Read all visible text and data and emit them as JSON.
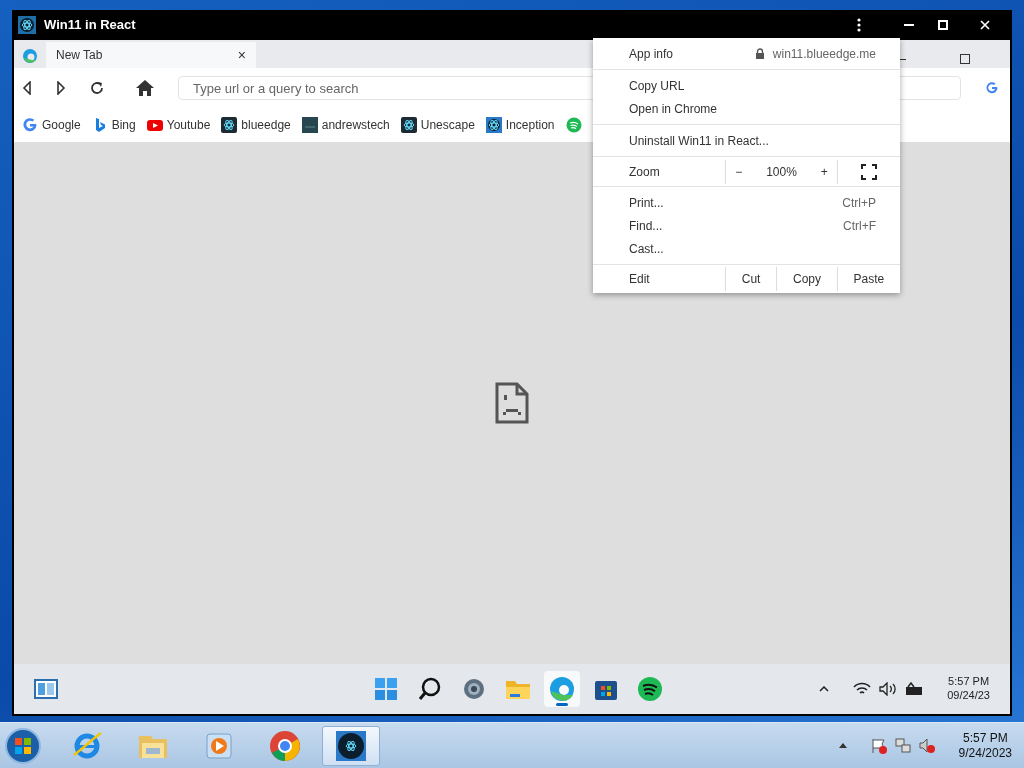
{
  "window": {
    "title": "Win11 in React"
  },
  "browser": {
    "tabs": [
      {
        "label": "New Tab",
        "close": "×",
        "selected": true
      }
    ],
    "address_bar": {
      "placeholder": "Type url or a query to search"
    },
    "bookmarks": [
      {
        "label": "Google",
        "kind": "google"
      },
      {
        "label": "Bing",
        "kind": "bing"
      },
      {
        "label": "Youtube",
        "kind": "youtube"
      },
      {
        "label": "blueedge",
        "kind": "react"
      },
      {
        "label": "andrewstech",
        "kind": "dark"
      },
      {
        "label": "Unescape",
        "kind": "react"
      },
      {
        "label": "Inception",
        "kind": "inception"
      },
      {
        "kind": "spotify"
      }
    ]
  },
  "menu": {
    "sections": [
      [
        {
          "kind": "info",
          "label": "App info",
          "url": "win11.blueedge.me"
        }
      ],
      [
        {
          "kind": "item",
          "label": "Copy URL"
        },
        {
          "kind": "item",
          "label": "Open in Chrome"
        }
      ],
      [
        {
          "kind": "item",
          "label": "Uninstall Win11 in React..."
        }
      ],
      [
        {
          "kind": "zoom",
          "label": "Zoom",
          "minus": "−",
          "value": "100%",
          "plus": "+"
        }
      ],
      [
        {
          "kind": "item",
          "label": "Print...",
          "shortcut": "Ctrl+P"
        },
        {
          "kind": "item",
          "label": "Find...",
          "shortcut": "Ctrl+F"
        },
        {
          "kind": "item",
          "label": "Cast..."
        }
      ],
      [
        {
          "kind": "edit",
          "label": "Edit",
          "buttons": [
            "Cut",
            "Copy",
            "Paste"
          ]
        }
      ]
    ]
  },
  "win11_taskbar": {
    "apps": [
      {
        "kind": "start",
        "active": false
      },
      {
        "kind": "search",
        "active": false
      },
      {
        "kind": "settings",
        "active": false
      },
      {
        "kind": "explorer",
        "active": false
      },
      {
        "kind": "edge",
        "active": true
      },
      {
        "kind": "store",
        "active": false
      },
      {
        "kind": "spotify",
        "active": false
      }
    ],
    "clock": {
      "time": "5:57 PM",
      "date": "09/24/23"
    }
  },
  "win7_taskbar": {
    "apps": [
      {
        "kind": "ie",
        "active": false
      },
      {
        "kind": "explorer",
        "active": false
      },
      {
        "kind": "media",
        "active": false
      },
      {
        "kind": "chrome",
        "active": false
      },
      {
        "kind": "react",
        "active": true
      }
    ],
    "clock": {
      "time": "5:57 PM",
      "date": "9/24/2023"
    }
  }
}
